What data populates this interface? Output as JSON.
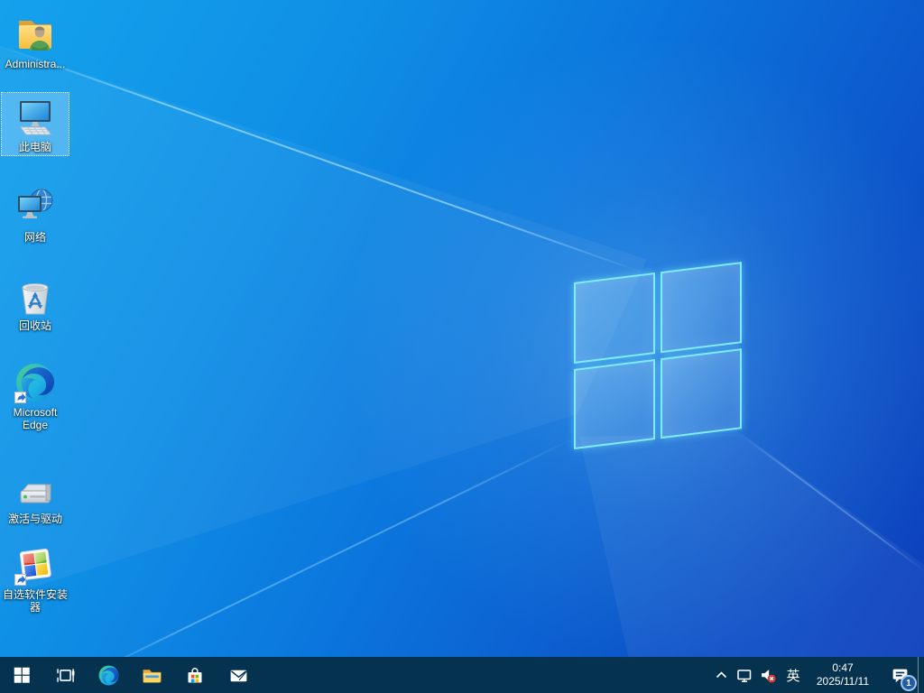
{
  "desktop": {
    "icons": [
      {
        "id": "administrator-folder",
        "label": "Administra..."
      },
      {
        "id": "this-pc",
        "label": "此电脑",
        "selected": true
      },
      {
        "id": "network",
        "label": "网络"
      },
      {
        "id": "recycle-bin",
        "label": "回收站"
      },
      {
        "id": "microsoft-edge",
        "label": "Microsoft Edge"
      },
      {
        "id": "activation-drivers",
        "label": "激活与驱动"
      },
      {
        "id": "software-installer",
        "label": "自选软件安装器"
      }
    ]
  },
  "taskbar": {
    "buttons": [
      "start",
      "task-view",
      "edge",
      "file-explorer",
      "microsoft-store",
      "mail"
    ],
    "tray": {
      "ime_label": "英",
      "time": "0:47",
      "date": "2025/11/11",
      "notification_count": "1"
    }
  },
  "colors": {
    "taskbar": "#05334f",
    "wallpaper_top_left": "#14a2ec",
    "wallpaper_bottom_right": "#0d3fbb",
    "logo_edge_glow": "#80f0ff",
    "badge_fill": "#235d9f",
    "mute_badge": "#d83b2f"
  }
}
